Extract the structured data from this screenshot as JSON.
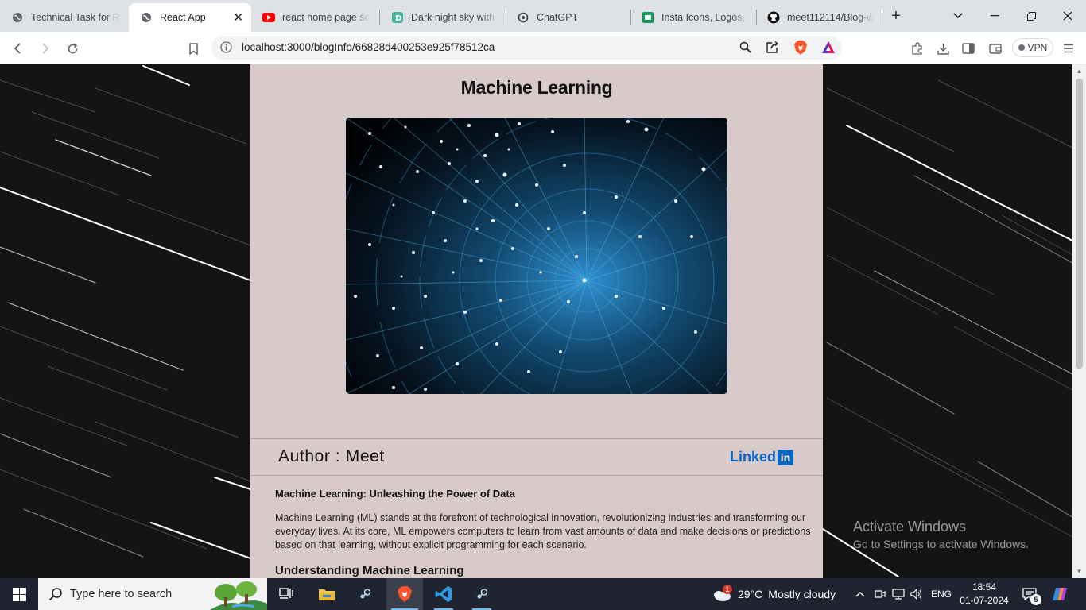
{
  "browser": {
    "tabs": [
      {
        "title": "Technical Task for Rea",
        "icon": "globe-icon",
        "active": false
      },
      {
        "title": "React App",
        "icon": "globe-icon",
        "active": true
      },
      {
        "title": "react home page scro",
        "icon": "youtube-icon",
        "active": false
      },
      {
        "title": "Dark night sky with b",
        "icon": "d-icon",
        "active": false
      },
      {
        "title": "ChatGPT",
        "icon": "chatgpt-icon",
        "active": false
      },
      {
        "title": "Insta Icons, Logos, Sy",
        "icon": "sheets-icon",
        "active": false
      },
      {
        "title": "meet112114/Blog-we",
        "icon": "github-icon",
        "active": false
      }
    ],
    "url": "localhost:3000/blogInfo/66828d400253e925f78512ca",
    "vpn_label": "VPN"
  },
  "article": {
    "title": "Machine Learning",
    "author": "Author : Meet",
    "linkedin_text": "Linked",
    "linkedin_badge": "in",
    "section_title": "Machine Learning: Unleashing the Power of Data",
    "paragraph": "Machine Learning (ML) stands at the forefront of technological innovation, revolutionizing industries and transforming our everyday lives. At its core, ML empowers computers to learn from vast amounts of data and make decisions or predictions based on that learning, without explicit programming for each scenario.",
    "subheading": "Understanding Machine Learning"
  },
  "watermark": {
    "line1": "Activate Windows",
    "line2": "Go to Settings to activate Windows."
  },
  "taskbar": {
    "search_placeholder": "Type here to search",
    "weather_temp": "29°C",
    "weather_desc": "Mostly cloudy",
    "weather_badge": "1",
    "language": "ENG",
    "time": "18:54",
    "date": "01-07-2024",
    "notification_count": "5"
  },
  "colors": {
    "article_bg": "#d8cacb",
    "linkedin_blue": "#0a66c2",
    "taskbar_bg": "#1f2430"
  }
}
